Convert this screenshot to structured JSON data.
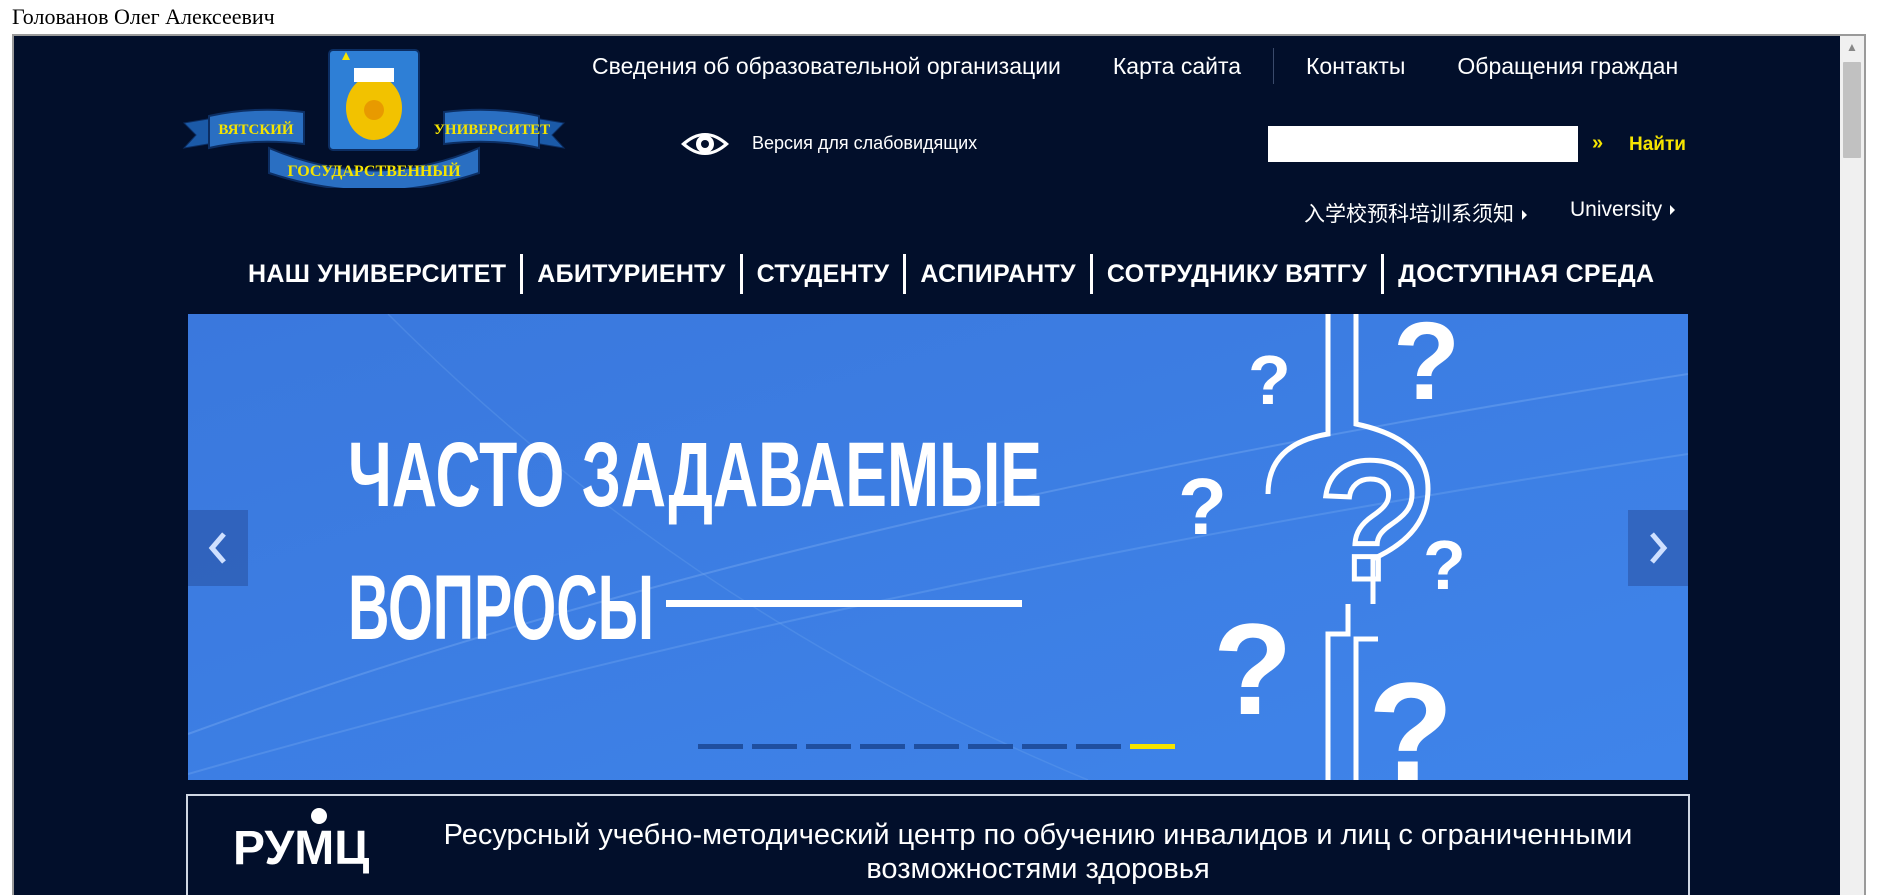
{
  "page": {
    "title": "Голованов Олег Алексеевич"
  },
  "top_links": [
    "Сведения об образовательной организации",
    "Карта сайта",
    "Контакты",
    "Обращения граждан"
  ],
  "logo": {
    "left_word": "ВЯТСКИЙ",
    "right_word": "УНИВЕРСИТЕТ",
    "bottom_word": "ГОСУДАРСТВЕННЫЙ"
  },
  "accessibility": {
    "label": "Версия для слабовидящих"
  },
  "search": {
    "placeholder": "",
    "value": "",
    "button_label": "Найти",
    "arrow": "»"
  },
  "languages": [
    {
      "label": "入学校预科培训系须知"
    },
    {
      "label": "University"
    }
  ],
  "main_nav": [
    "НАШ УНИВЕРСИТЕТ",
    "АБИТУРИЕНТУ",
    "СТУДЕНТУ",
    "АСПИРАНТУ",
    "СОТРУДНИКУ ВЯТГУ",
    "ДОСТУПНАЯ СРЕДА"
  ],
  "slider": {
    "headline_line1": "ЧАСТО ЗАДАВАЕМЫЕ",
    "headline_line2": "ВОПРОСЫ",
    "active_index": 8,
    "dot_count": 9,
    "background_color": "#3f7fe0"
  },
  "rumc": {
    "logo_text": "РУМЦ",
    "text": "Ресурсный учебно-методический центр по обучению инвалидов и лиц с ограниченными возможностями здоровья"
  },
  "colors": {
    "background": "#020f2b",
    "accent": "#f5e400",
    "text": "#ffffff"
  }
}
